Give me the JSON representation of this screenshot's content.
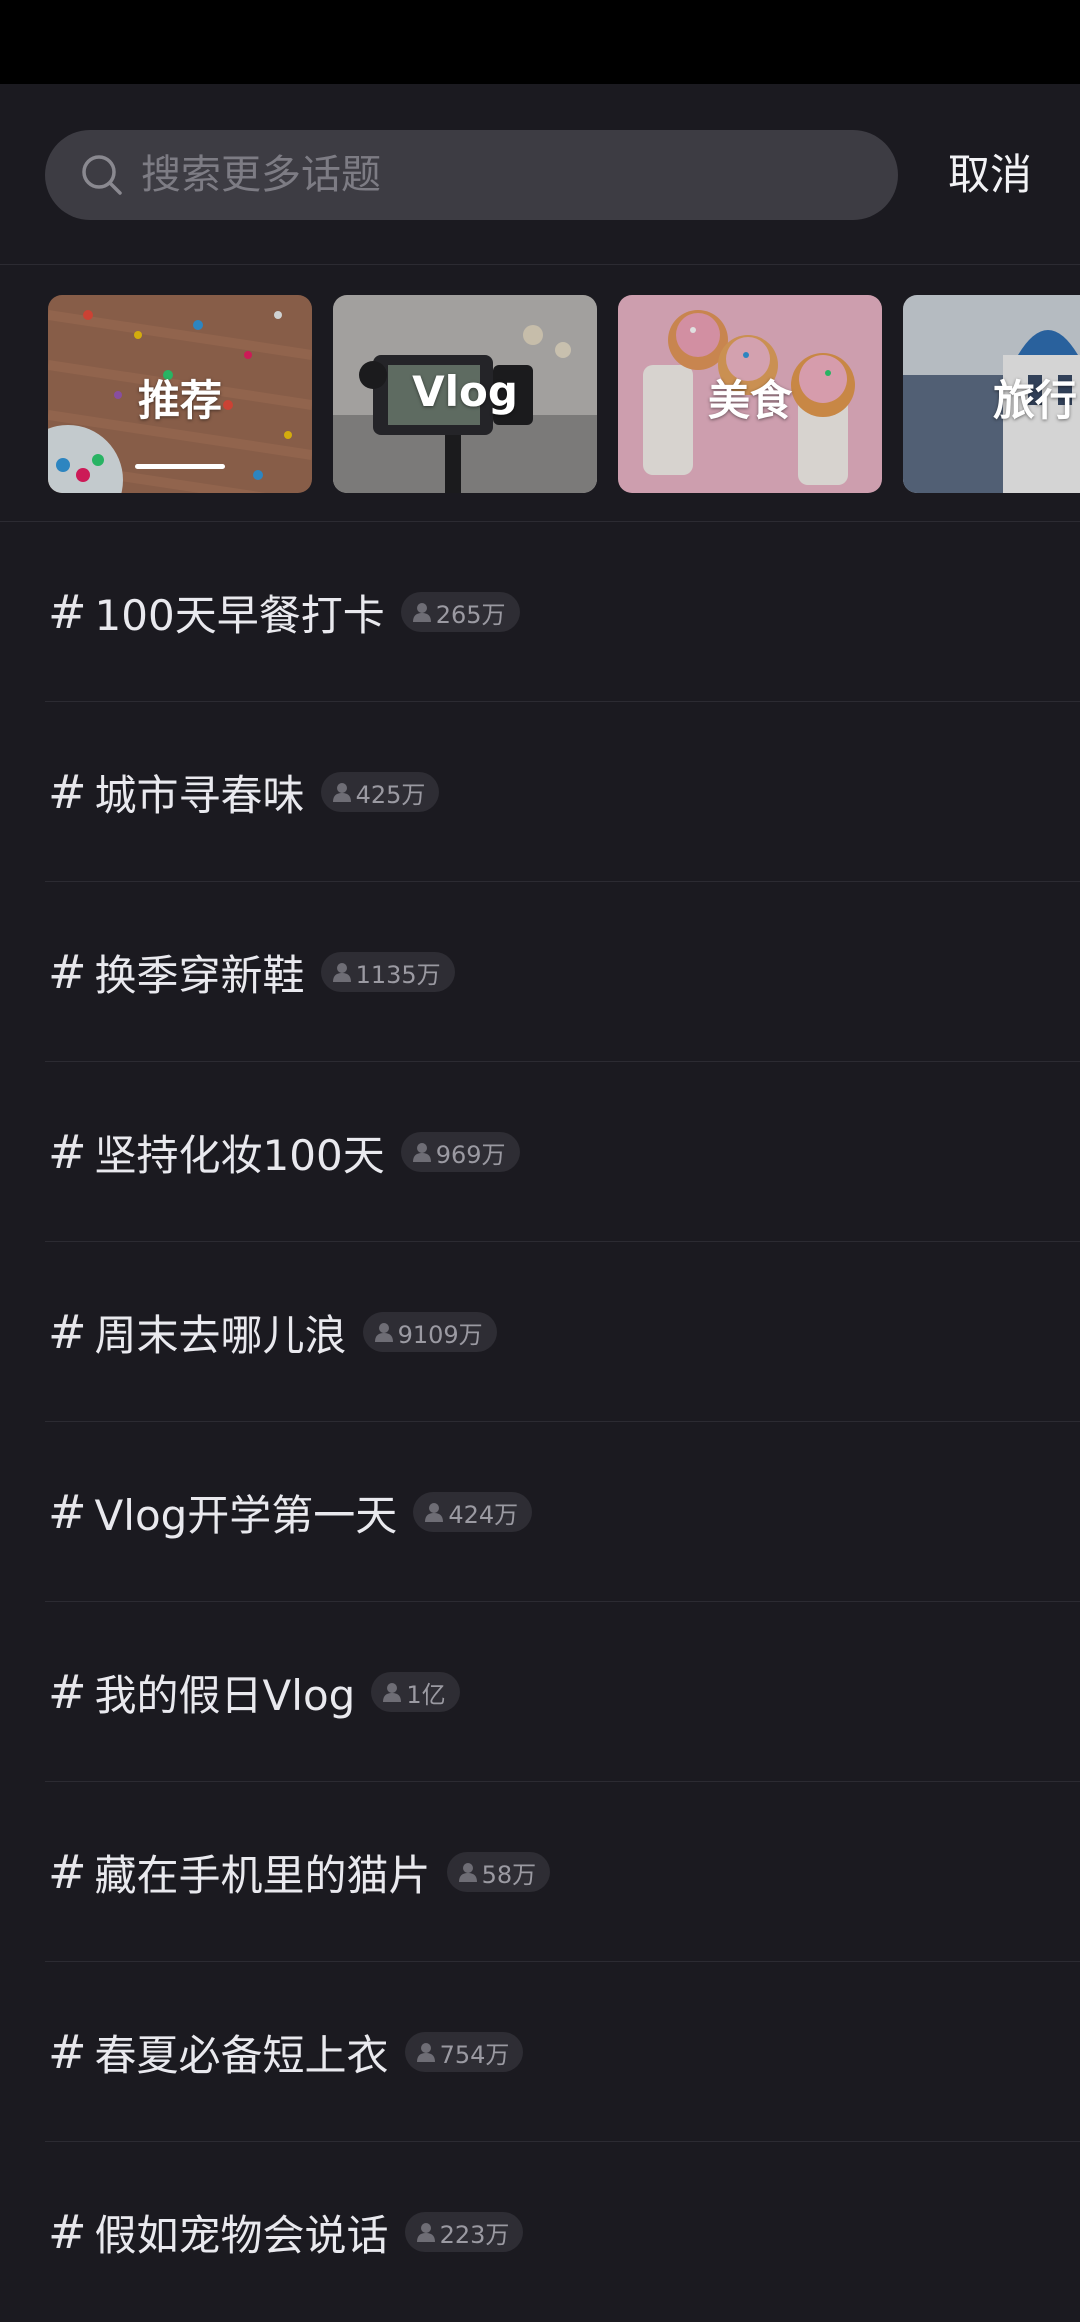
{
  "search": {
    "placeholder": "搜索更多话题",
    "cancel_label": "取消"
  },
  "categories": [
    {
      "label": "推荐",
      "active": true
    },
    {
      "label": "Vlog",
      "active": false
    },
    {
      "label": "美食",
      "active": false
    },
    {
      "label": "旅行",
      "active": false
    }
  ],
  "topics": [
    {
      "hash": "#",
      "title": "100天早餐打卡",
      "count": "265万"
    },
    {
      "hash": "#",
      "title": "城市寻春味",
      "count": "425万"
    },
    {
      "hash": "#",
      "title": "换季穿新鞋",
      "count": "1135万"
    },
    {
      "hash": "#",
      "title": "坚持化妆100天",
      "count": "969万"
    },
    {
      "hash": "#",
      "title": "周末去哪儿浪",
      "count": "9109万"
    },
    {
      "hash": "#",
      "title": "Vlog开学第一天",
      "count": "424万"
    },
    {
      "hash": "#",
      "title": "我的假日Vlog",
      "count": "1亿"
    },
    {
      "hash": "#",
      "title": "藏在手机里的猫片",
      "count": "58万"
    },
    {
      "hash": "#",
      "title": "春夏必备短上衣",
      "count": "754万"
    },
    {
      "hash": "#",
      "title": "假如宠物会说话",
      "count": "223万"
    }
  ],
  "icons": {
    "search": "search-icon",
    "user": "user-icon"
  }
}
